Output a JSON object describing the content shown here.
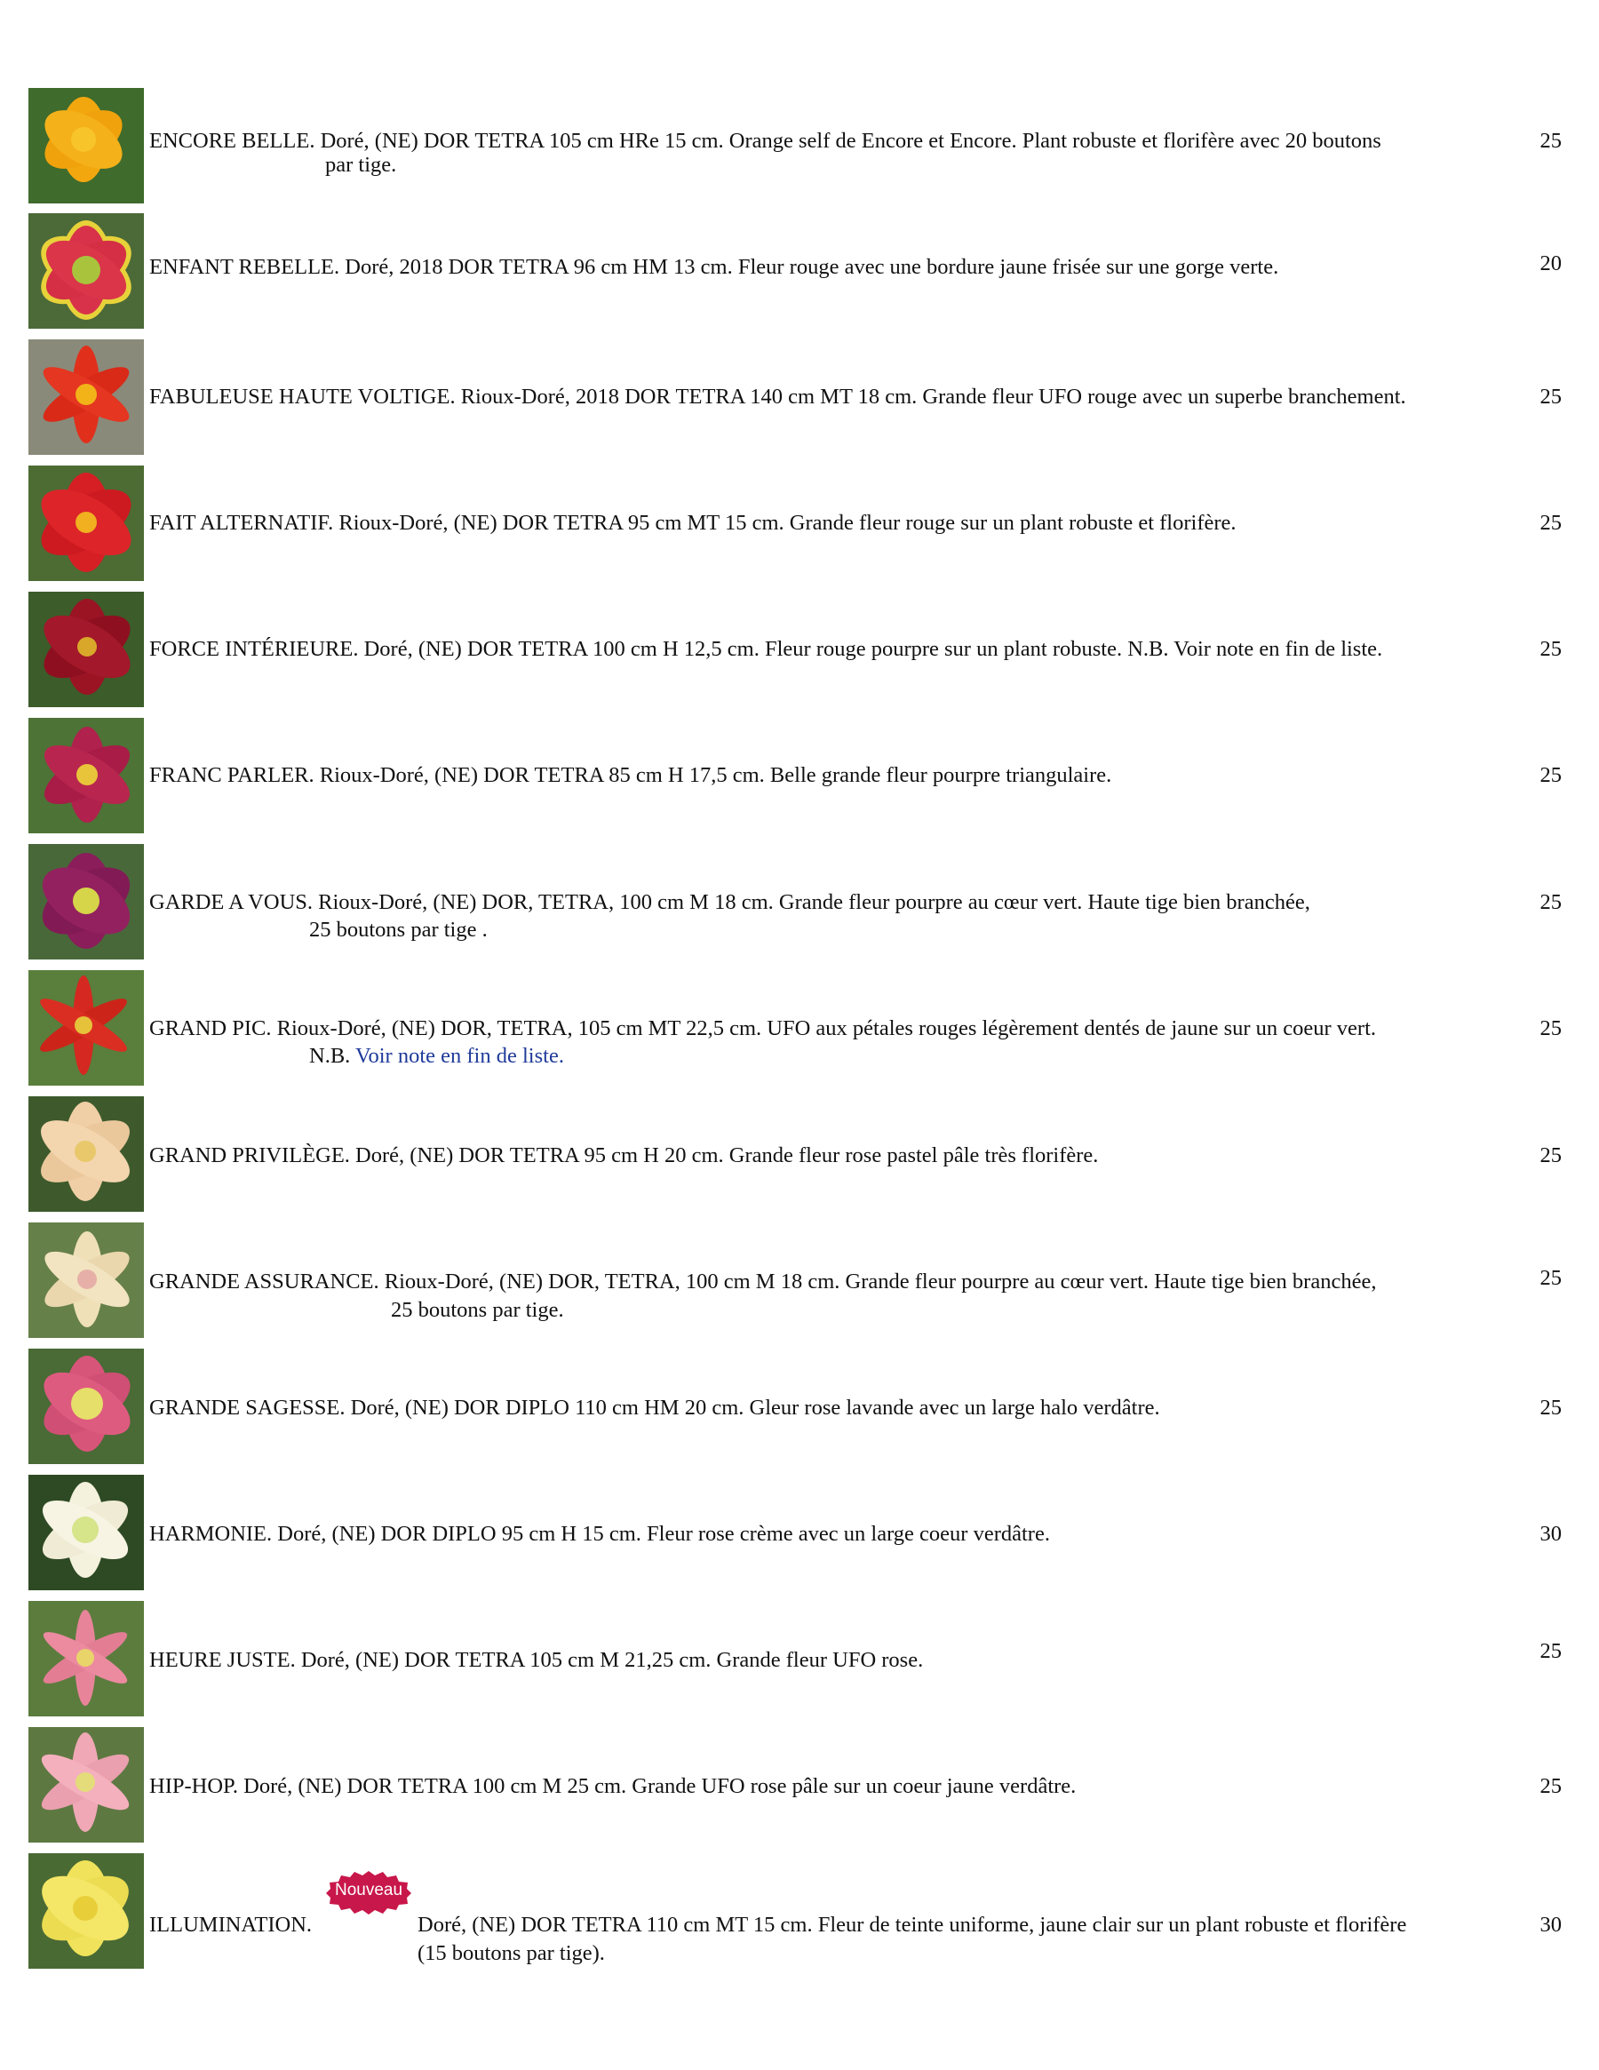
{
  "colors": {
    "text": "#111111",
    "link": "#1f3a9a",
    "badge": "#c8174a"
  },
  "entries": [
    {
      "image": "daylily-yellow-orange-photo",
      "text": "ENCORE BELLE. Doré, (NE) DOR TETRA 105 cm HRe 15 cm. Orange self de Encore et Encore. Plant robuste et florifère avec 20 boutons",
      "cont": "par tige.",
      "price": "25"
    },
    {
      "image": "daylily-red-yellow-edge-photo",
      "text": "ENFANT REBELLE. Doré, 2018 DOR TETRA 96 cm HM 13 cm. Fleur rouge avec une bordure jaune frisée sur une gorge verte.",
      "price": "20"
    },
    {
      "image": "daylily-red-ufo-photo",
      "text": "FABULEUSE HAUTE VOLTIGE. Rioux-Doré, 2018 DOR TETRA 140 cm MT 18 cm. Grande fleur UFO rouge avec un superbe branchement.",
      "price": "25"
    },
    {
      "image": "daylily-red-photo",
      "text": "FAIT ALTERNATIF. Rioux-Doré, (NE) DOR TETRA 95 cm MT 15 cm. Grande fleur rouge sur un plant robuste et florifère.",
      "price": "25"
    },
    {
      "image": "daylily-red-purple-photo",
      "text": "FORCE INTÉRIEURE. Doré, (NE) DOR TETRA 100 cm H 12,5 cm. Fleur rouge pourpre sur un plant robuste. N.B. Voir note en fin de liste.",
      "price": "25"
    },
    {
      "image": "daylily-purple-triangular-photo",
      "text": "FRANC PARLER. Rioux-Doré, (NE) DOR TETRA 85 cm H 17,5 cm. Belle grande fleur pourpre triangulaire.",
      "price": "25"
    },
    {
      "image": "daylily-purple-green-heart-photo",
      "text": "GARDE A VOUS. Rioux-Doré, (NE) DOR, TETRA, 100 cm M 18 cm. Grande fleur pourpre au cœur vert. Haute tige bien branchée,",
      "cont": "25 boutons par tige .",
      "price": "25"
    },
    {
      "image": "daylily-red-ufo-spider-photo",
      "text": "GRAND PIC. Rioux-Doré, (NE) DOR, TETRA, 105 cm MT 22,5 cm. UFO aux pétales rouges légèrement dentés de jaune sur un coeur vert.",
      "cont_prefix": "N.B. ",
      "cont_link": "Voir note en fin de liste.",
      "price": "25"
    },
    {
      "image": "daylily-pastel-pink-photo",
      "text": "GRAND PRIVILÈGE. Doré, (NE) DOR TETRA 95 cm H 20 cm. Grande fleur rose pastel pâle très florifère.",
      "price": "25"
    },
    {
      "image": "daylily-cream-pink-photo",
      "text": "GRANDE ASSURANCE. Rioux-Doré, (NE) DOR, TETRA, 100 cm M 18 cm. Grande fleur pourpre au cœur vert. Haute tige bien branchée,",
      "cont": "25 boutons par tige.",
      "price": "25"
    },
    {
      "image": "daylily-lavender-pink-photo",
      "text": "GRANDE SAGESSE. Doré, (NE) DOR DIPLO 110 cm HM 20 cm. Gleur rose lavande avec un large halo verdâtre.",
      "price": "25"
    },
    {
      "image": "daylily-cream-green-photo",
      "text": "HARMONIE. Doré, (NE) DOR DIPLO 95 cm H 15 cm. Fleur rose crème avec un large coeur verdâtre.",
      "price": "30"
    },
    {
      "image": "daylily-pink-ufo-photo",
      "text": "HEURE JUSTE. Doré, (NE) DOR TETRA 105 cm M 21,25 cm. Grande fleur UFO rose.",
      "price": "25"
    },
    {
      "image": "daylily-pale-pink-ufo-photo",
      "text": "HIP-HOP. Doré, (NE) DOR TETRA 100 cm M 25 cm. Grande UFO rose pâle sur un coeur jaune verdâtre.",
      "price": "25"
    },
    {
      "image": "daylily-light-yellow-photo",
      "name": "ILLUMINATION.",
      "badge": "Nouveau",
      "text": "Doré, (NE) DOR TETRA 110 cm MT 15 cm. Fleur de teinte uniforme, jaune clair sur un plant robuste et florifère",
      "cont": "(15 boutons par tige).",
      "price": "30"
    }
  ]
}
